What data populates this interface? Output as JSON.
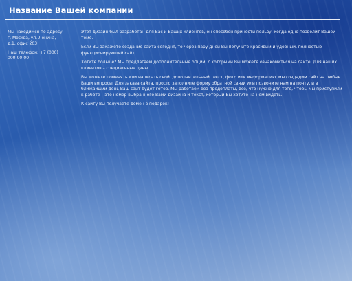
{
  "header": {
    "company_name": "Название Вашей компании"
  },
  "sidebar": {
    "address": "Мы находимся по адресу г. Москва, ул. Ленина, д.1, офис 203",
    "phone": "Наш телефон: +7 (000) 000-00-00"
  },
  "main": {
    "paragraphs": [
      "Этот дизайн был разработан для Вас и Ваших клиентов, он способен принести пользу, когда одно позволит Вашей теме.",
      "Если Вы закажете создание сайта сегодня, то через пару дней Вы получите красивый и удобный, полностью функционирующий сайт.",
      "Хотите больше? Мы предлагаем дополнительные опции, с которыми Вы можете ознакомиться на сайте. Для наших клиентов – специальные цены.",
      "Вы можете поменять или написать свой, дополнительный текст, фото или информацию, мы создадим сайт на любые Ваши вопросы. Для заказа сайта, просто заполните форму обратной связи или позвоните нам на почту, и в ближайший день Ваш сайт будет готов. Мы работаем без предоплаты, все, что нужно для того, чтобы мы приступили к работе – это номер выбранного Вами дизайна и текст, который Вы хотите на нем видеть.",
      "К сайту Вы получаете домен в подарок!"
    ]
  }
}
